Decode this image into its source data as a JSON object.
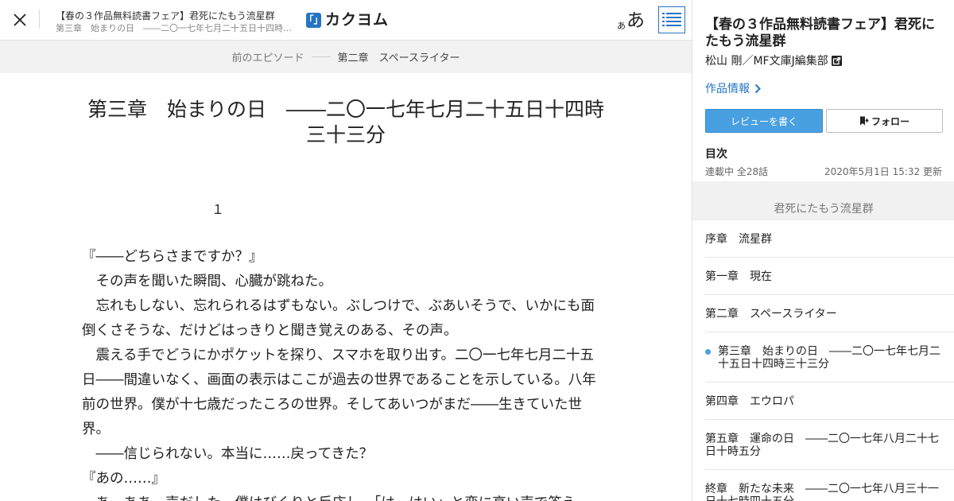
{
  "header": {
    "work_title": "【春の３作品無料読書フェア】君死にたもう流星群",
    "episode_title": "第三章　始まりの日　――二〇一七年七月二十五日十四時三十三分",
    "logo_mark": "「」",
    "logo_text": "カクヨム",
    "font_small": "あ",
    "font_big": "あ"
  },
  "nav": {
    "prev_label": "前のエピソード",
    "prev_title": "第二章　スペースライター"
  },
  "content": {
    "chapter_heading": "第三章　始まりの日　――二〇一七年七月二十五日十四時三十三分",
    "section_number": "１",
    "paragraphs": [
      "『――どちらさまですか？』",
      "　その声を聞いた瞬間、心臓が跳ねた。",
      "　忘れもしない、忘れられるはずもない。ぶしつけで、ぶあいそうで、いかにも面倒くさそうな、だけどはっきりと聞き覚えのある、その声。",
      "　震える手でどうにかポケットを探り、スマホを取り出す。二〇一七年七月二十五日――間違いなく、画面の表示はここが過去の世界であることを示している。八年前の世界。僕が十七歳だったころの世界。そしてあいつがまだ――生きていた世界。",
      "　――信じられない。本当に……戻ってきた？",
      "『あの……』",
      "　あ、ああ、声だした。僕はびくりと反応し、「は、はい」と変に高い声で答え"
    ]
  },
  "sidebar": {
    "title": "【春の３作品無料読書フェア】君死にたもう流星群",
    "author": "松山 剛／MF文庫J編集部",
    "info_link": "作品情報",
    "review_button": "レビューを書く",
    "follow_button": "フォロー",
    "toc_label": "目次",
    "toc_status": "連載中 全28話",
    "toc_updated": "2020年5月1日 15:32 更新",
    "toc_header": "君死にたもう流星群",
    "toc_items": [
      "序章　流星群",
      "第一章　現在",
      "第二章　スペースライター",
      "第三章　始まりの日　――二〇一七年七月二十五日十四時三十三分",
      "第四章　エウロパ",
      "第五章　運命の日　――二〇一七年八月二十七日十時五分",
      "終章　新たな未来　――二〇一七年八月三十一日十七時四十五分"
    ]
  },
  "colors": {
    "accent": "#2574c4",
    "review_button": "#49a0e1",
    "current_dot": "#49a0e1"
  },
  "icons": [
    "close-icon",
    "list-icon",
    "external-link-icon",
    "chevron-right-icon",
    "bookmark-plus-icon"
  ]
}
